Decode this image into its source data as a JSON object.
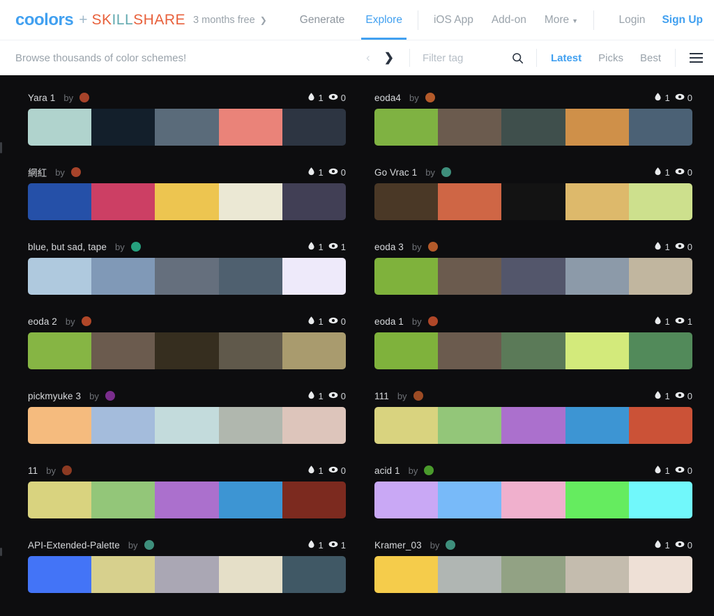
{
  "header": {
    "logo": "coolors",
    "plus": "+",
    "partner_segments": [
      {
        "text": "SK",
        "tone": "orange"
      },
      {
        "text": "ILL",
        "tone": "teal"
      },
      {
        "text": "SHARE",
        "tone": "orange"
      }
    ],
    "promo": "3 months free",
    "promo_chevron": "❯",
    "nav_main": [
      {
        "label": "Generate",
        "active": false
      },
      {
        "label": "Explore",
        "active": true
      }
    ],
    "nav_secondary": [
      {
        "label": "iOS App",
        "caret": false
      },
      {
        "label": "Add-on",
        "caret": false
      },
      {
        "label": "More",
        "caret": true
      }
    ],
    "caret_glyph": "▼",
    "login": "Login",
    "signup": "Sign Up",
    "accent_color": "#41a0f0"
  },
  "subheader": {
    "browse_text": "Browse thousands of color schemes!",
    "prev_arrow": "‹",
    "next_arrow": "❯",
    "filter_placeholder": "Filter tag",
    "filter_value": "",
    "search_icon": "search-icon",
    "sorts": [
      {
        "label": "Latest",
        "active": true
      },
      {
        "label": "Picks",
        "active": false
      },
      {
        "label": "Best",
        "active": false
      }
    ],
    "menu_icon": "hamburger-icon"
  },
  "palettes": [
    {
      "title": "Yara 1",
      "by": "by",
      "avatar_color": "#a6432a",
      "likes": "1",
      "views": "0",
      "colors": [
        "#b0d3cd",
        "#131f2b",
        "#5a6b7a",
        "#ea8379",
        "#2d3542"
      ]
    },
    {
      "title": "eoda4",
      "by": "by",
      "avatar_color": "#b35a2a",
      "likes": "1",
      "views": "0",
      "colors": [
        "#7fb242",
        "#6b5b4e",
        "#3f4f4c",
        "#cf9049",
        "#4b6175"
      ]
    },
    {
      "title": "網紅",
      "by": "by",
      "avatar_color": "#a6432a",
      "likes": "1",
      "views": "0",
      "colors": [
        "#2550a8",
        "#cc3f64",
        "#edc550",
        "#ebe8d4",
        "#413f55"
      ]
    },
    {
      "title": "Go Vrac 1",
      "by": "by",
      "avatar_color": "#3e8f7c",
      "likes": "1",
      "views": "0",
      "colors": [
        "#4a3826",
        "#cf6645",
        "#131313",
        "#ddb96b",
        "#cde08d"
      ]
    },
    {
      "title": "blue, but sad, tape",
      "by": "by",
      "avatar_color": "#26a07e",
      "likes": "1",
      "views": "1",
      "colors": [
        "#afc9de",
        "#8099b7",
        "#656f7d",
        "#4f606f",
        "#eeeafa"
      ]
    },
    {
      "title": "eoda 3",
      "by": "by",
      "avatar_color": "#b35a2a",
      "likes": "1",
      "views": "0",
      "colors": [
        "#7fb23c",
        "#6b5b4e",
        "#53566b",
        "#8c9aa9",
        "#c1b69f"
      ]
    },
    {
      "title": "eoda 2",
      "by": "by",
      "avatar_color": "#b04728",
      "likes": "1",
      "views": "0",
      "colors": [
        "#86b544",
        "#6b5b4e",
        "#362e1f",
        "#60594b",
        "#a99b6e"
      ]
    },
    {
      "title": "eoda 1",
      "by": "by",
      "avatar_color": "#b04728",
      "likes": "1",
      "views": "1",
      "colors": [
        "#7fb23c",
        "#6b5b4e",
        "#5b7a58",
        "#d3ea7b",
        "#528a5a"
      ]
    },
    {
      "title": "pickmyuke 3",
      "by": "by",
      "avatar_color": "#7a2d8c",
      "likes": "1",
      "views": "0",
      "colors": [
        "#f5bb7e",
        "#a4bcdc",
        "#c3dbdc",
        "#b0b7ae",
        "#ddc5bb"
      ]
    },
    {
      "title": "111",
      "by": "by",
      "avatar_color": "#9c4b24",
      "likes": "1",
      "views": "0",
      "colors": [
        "#d9d37f",
        "#93c679",
        "#ab70cd",
        "#3d95d3",
        "#cb5237"
      ]
    },
    {
      "title": "11",
      "by": "by",
      "avatar_color": "#8c3a22",
      "likes": "1",
      "views": "0",
      "colors": [
        "#d9d37f",
        "#93c679",
        "#ab70cd",
        "#3d95d3",
        "#7c2a1f"
      ]
    },
    {
      "title": "acid 1",
      "by": "by",
      "avatar_color": "#4a9a2c",
      "likes": "1",
      "views": "0",
      "colors": [
        "#c9a8f5",
        "#78baf9",
        "#f0b0cd",
        "#65ec5f",
        "#71f8fb"
      ]
    },
    {
      "title": "API-Extended-Palette",
      "by": "by",
      "avatar_color": "#3e8f7c",
      "likes": "1",
      "views": "1",
      "colors": [
        "#4374f7",
        "#d7d08d",
        "#aaa7b4",
        "#e5dfc8",
        "#405865"
      ]
    },
    {
      "title": "Kramer_03",
      "by": "by",
      "avatar_color": "#3e8f7c",
      "likes": "1",
      "views": "0",
      "colors": [
        "#f5cc4b",
        "#b0b6b3",
        "#92a284",
        "#c4bcae",
        "#eee0d6"
      ]
    }
  ]
}
